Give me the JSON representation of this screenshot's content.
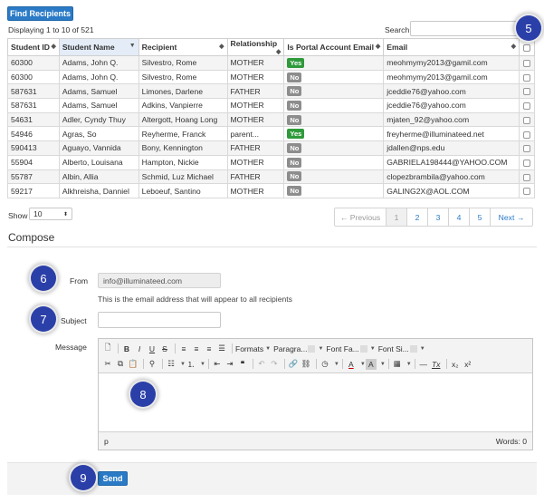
{
  "find_button": "Find Recipients",
  "display_info": "Displaying 1 to 10 of 521",
  "search_label": "Search",
  "search_value": "",
  "table": {
    "columns": [
      "Student ID",
      "Student Name",
      "Recipient",
      "Relationship",
      "Is Portal Account Email",
      "Email"
    ],
    "rows": [
      {
        "id": "60300",
        "student": "Adams, John Q.",
        "recipient": "Silvestro, Rome",
        "relationship": "MOTHER",
        "portal": "Yes",
        "email": "meohmymy2013@gamil.com"
      },
      {
        "id": "60300",
        "student": "Adams, John Q.",
        "recipient": "Silvestro, Rome",
        "relationship": "MOTHER",
        "portal": "No",
        "email": "meohmymy2013@gamil.com"
      },
      {
        "id": "587631",
        "student": "Adams, Samuel",
        "recipient": "Limones, Darlene",
        "relationship": "FATHER",
        "portal": "No",
        "email": "jceddie76@yahoo.com"
      },
      {
        "id": "587631",
        "student": "Adams, Samuel",
        "recipient": "Adkins, Vanpierre",
        "relationship": "MOTHER",
        "portal": "No",
        "email": "jceddie76@yahoo.com"
      },
      {
        "id": "54631",
        "student": "Adler, Cyndy Thuy",
        "recipient": "Altergott, Hoang Long",
        "relationship": "MOTHER",
        "portal": "No",
        "email": "mjaten_92@yahoo.com"
      },
      {
        "id": "54946",
        "student": "Agras, So",
        "recipient": "Reyherme, Franck",
        "relationship": "parent...",
        "portal": "Yes",
        "email": "freyherme@illuminateed.net"
      },
      {
        "id": "590413",
        "student": "Aguayo, Vannida",
        "recipient": "Bony, Kennington",
        "relationship": "FATHER",
        "portal": "No",
        "email": "jdallen@nps.edu"
      },
      {
        "id": "55904",
        "student": "Alberto, Louisana",
        "recipient": "Hampton, Nickie",
        "relationship": "MOTHER",
        "portal": "No",
        "email": "GABRIELA198444@YAHOO.COM"
      },
      {
        "id": "55787",
        "student": "Albin, Allia",
        "recipient": "Schmid, Luz Michael",
        "relationship": "FATHER",
        "portal": "No",
        "email": "clopezbrambila@yahoo.com"
      },
      {
        "id": "59217",
        "student": "Alkhreisha, Danniel",
        "recipient": "Leboeuf, Santino",
        "relationship": "MOTHER",
        "portal": "No",
        "email": "GALING2X@AOL.COM"
      }
    ]
  },
  "show_label": "Show",
  "show_value": "10",
  "pagination": {
    "previous": "← Previous",
    "pages": [
      "1",
      "2",
      "3",
      "4",
      "5"
    ],
    "next": "Next →"
  },
  "compose": {
    "heading": "Compose",
    "from_label": "From",
    "from_value": "info@illuminateed.com",
    "from_hint": "This is the email address that will appear to all recipients",
    "subject_label": "Subject",
    "subject_value": "",
    "message_label": "Message",
    "toolbar": {
      "bold": "B",
      "italic": "I",
      "underline": "U",
      "strike": "S",
      "formats": "Formats",
      "paragraph": "Paragra...",
      "font_family": "Font Fa...",
      "font_size": "Font Si...",
      "quote": "❝",
      "text_color_a": "A",
      "bg_color_a": "A",
      "remove_format": "Tx",
      "subscript": "x₂",
      "superscript": "x²"
    },
    "status_path": "p",
    "word_count": "Words: 0",
    "send": "Send"
  },
  "markers": [
    "5",
    "6",
    "7",
    "8",
    "9"
  ],
  "colors": {
    "primary": "#2a7ac6",
    "yes_badge": "#2f9a3b",
    "no_badge": "#8d8d8d",
    "marker": "#2b3fa8"
  }
}
